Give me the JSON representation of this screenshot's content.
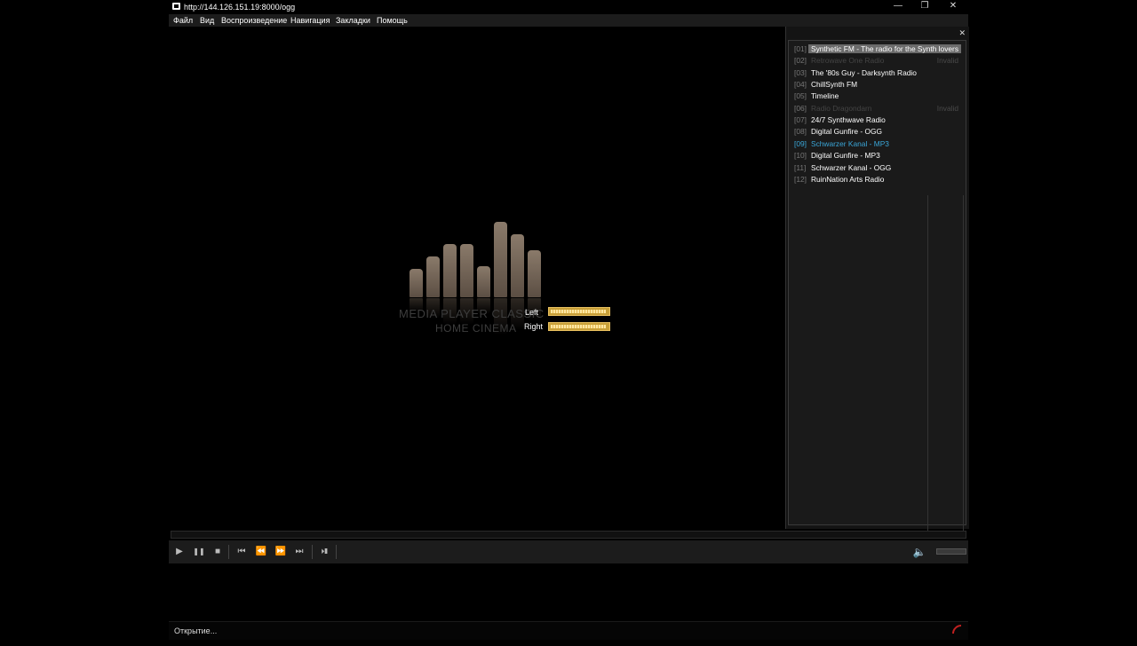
{
  "window": {
    "title": "http://144.126.151.19:8000/ogg",
    "minimize": "—",
    "restore": "❐",
    "close": "✕"
  },
  "menu": [
    "Файл",
    "Вид",
    "Воспроизведение",
    "Навигация",
    "Закладки",
    "Помощь"
  ],
  "video": {
    "logo_line1": "MEDIA PLAYER CLASSIC",
    "logo_line2": "HOME CINEMA",
    "vu": [
      {
        "label": "Left",
        "level": 0.97
      },
      {
        "label": "Right",
        "level": 0.97
      }
    ]
  },
  "playlist": {
    "close": "✕",
    "items": [
      {
        "num": "[01]",
        "title": "Synthetic FM - The radio for the Synth lovers",
        "state": "selected",
        "note": ""
      },
      {
        "num": "[02]",
        "title": "Retrowave One Radio",
        "state": "disabled",
        "note": "Invalid"
      },
      {
        "num": "[03]",
        "title": "The '80s Guy - Darksynth Radio",
        "state": "normal",
        "note": ""
      },
      {
        "num": "[04]",
        "title": "ChillSynth FM",
        "state": "normal",
        "note": ""
      },
      {
        "num": "[05]",
        "title": "Timeline",
        "state": "normal",
        "note": ""
      },
      {
        "num": "[06]",
        "title": "Radio Dragondarn",
        "state": "disabled",
        "note": "Invalid"
      },
      {
        "num": "[07]",
        "title": "24/7 Synthwave Radio",
        "state": "normal",
        "note": ""
      },
      {
        "num": "[08]",
        "title": "Digital Gunfire - OGG",
        "state": "normal",
        "note": ""
      },
      {
        "num": "[09]",
        "title": "Schwarzer Kanal - MP3",
        "state": "current",
        "note": ""
      },
      {
        "num": "[10]",
        "title": "Digital Gunfire - MP3",
        "state": "normal",
        "note": ""
      },
      {
        "num": "[11]",
        "title": "Schwarzer Kanal - OGG",
        "state": "normal",
        "note": ""
      },
      {
        "num": "[12]",
        "title": "RuinNation Arts Radio",
        "state": "normal",
        "note": ""
      }
    ]
  },
  "controls": {
    "play": "▶",
    "pause": "❚❚",
    "stop": "■",
    "prev": "⏮",
    "rewind": "⏪",
    "forward": "⏩",
    "next": "⏭",
    "frame_step": "⏵❚",
    "volume_icon": "🔈",
    "volume_level": 0.0
  },
  "status": {
    "text": "Открытие..."
  }
}
